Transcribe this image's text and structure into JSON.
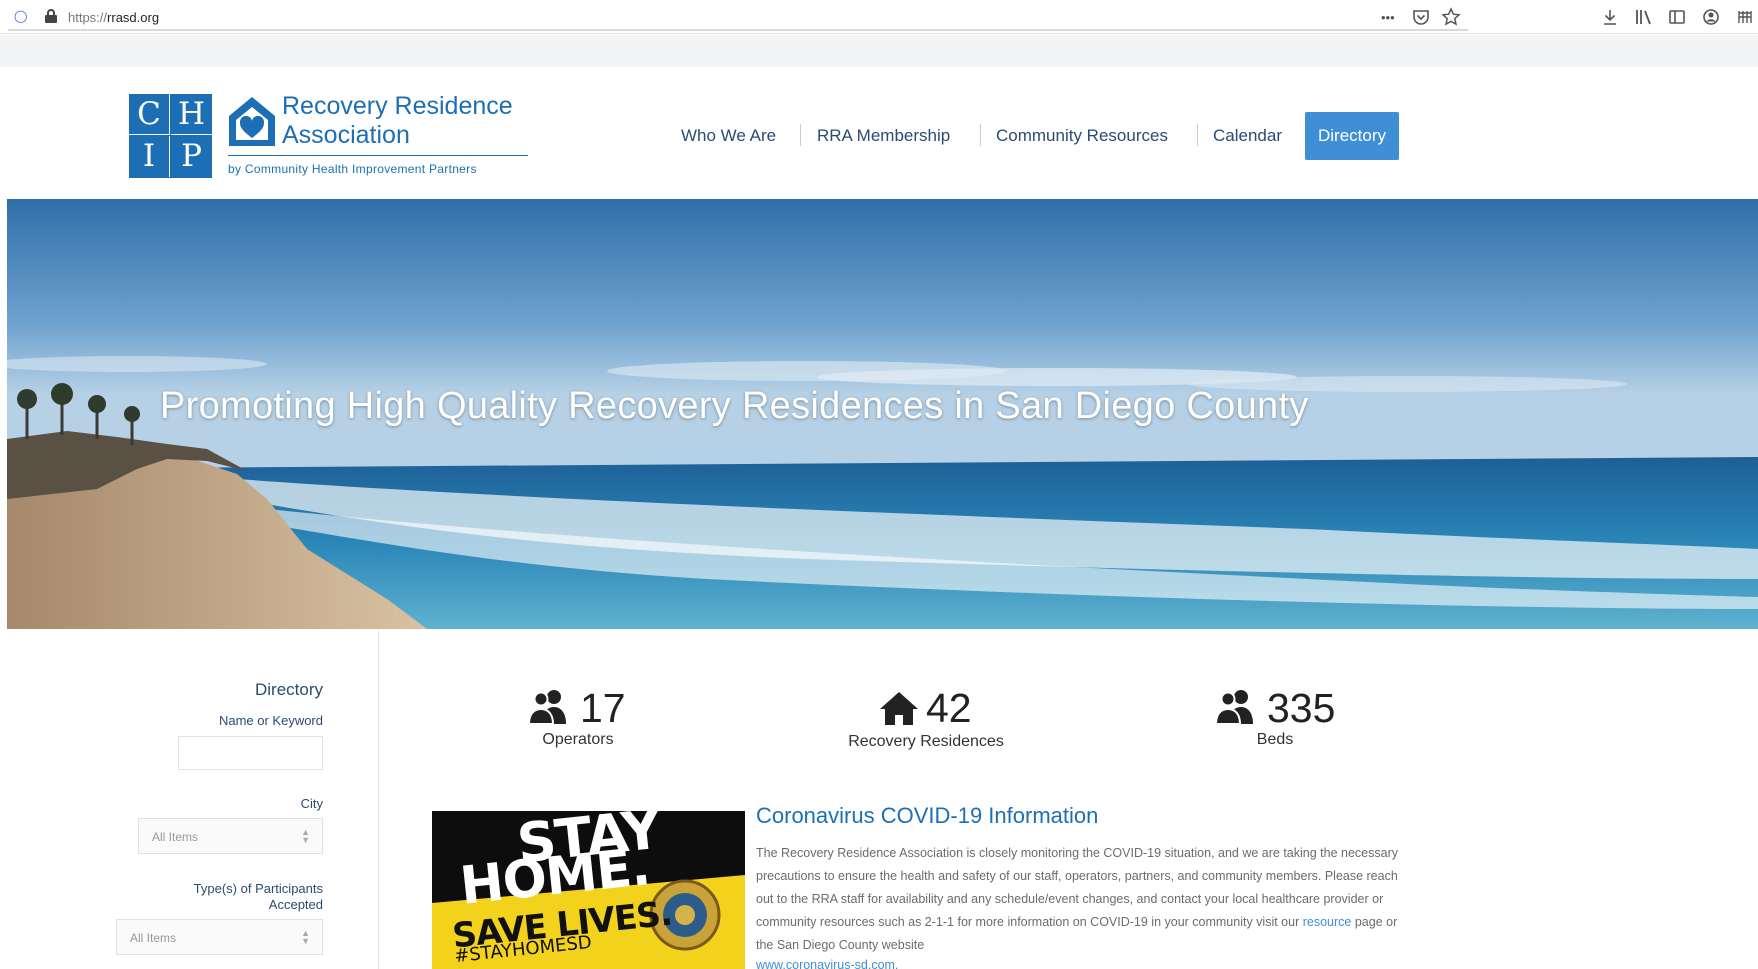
{
  "browser": {
    "url_prefix": "https://",
    "url_host": "rrasd.org",
    "icons": [
      "shield-icon",
      "lock-icon",
      "more-icon",
      "pocket-icon",
      "bookmark-star-icon",
      "download-icon",
      "library-icon",
      "sidebar-icon",
      "account-icon",
      "menu-icon"
    ]
  },
  "header": {
    "logo_letters": [
      "C",
      "H",
      "I",
      "P"
    ],
    "org_name_line1": "Recovery Residence",
    "org_name_line2": "Association",
    "org_sub": "by Community Health Improvement Partners",
    "nav": [
      {
        "label": "Who We Are"
      },
      {
        "label": "RRA Membership"
      },
      {
        "label": "Community Resources"
      },
      {
        "label": "Calendar"
      },
      {
        "label": "Directory",
        "active": true
      }
    ]
  },
  "hero": {
    "title": "Promoting High Quality Recovery Residences in San Diego County"
  },
  "sidebar": {
    "heading": "Directory",
    "name_label": "Name or Keyword",
    "name_value": "",
    "city_label": "City",
    "city_value": "All Items",
    "participants_label_line1": "Type(s) of Participants",
    "participants_label_line2": "Accepted",
    "participants_value": "All Items"
  },
  "stats": [
    {
      "icon": "users-icon",
      "value": "17",
      "label": "Operators"
    },
    {
      "icon": "home-icon",
      "value": "42",
      "label": "Recovery Residences"
    },
    {
      "icon": "users-icon",
      "value": "335",
      "label": "Beds"
    }
  ],
  "covid": {
    "image_text_stay": "STAY",
    "image_text_home": "HOME.",
    "image_text_save": "SAVE LIVES.",
    "image_text_hashtag": "#STAYHOMESD",
    "title": "Coronavirus COVID-19 Information",
    "body_before_link": "The Recovery Residence Association is closely monitoring the COVID-19 situation, and we are taking the necessary precautions to ensure the health and safety of our staff, operators, partners, and community members. Please reach out to the RRA staff for availability and any schedule/event changes, and contact your local healthcare provider or community resources such as 2-1-1 for more information on COVID-19 in your community visit our ",
    "link_text": "resource",
    "body_after_link": " page or the San Diego County website",
    "url_text": "www.coronavirus-sd.com."
  },
  "colors": {
    "brand_blue": "#1d6fb5",
    "nav_active": "#3f8fd7",
    "nav_text": "#2a4b73"
  }
}
